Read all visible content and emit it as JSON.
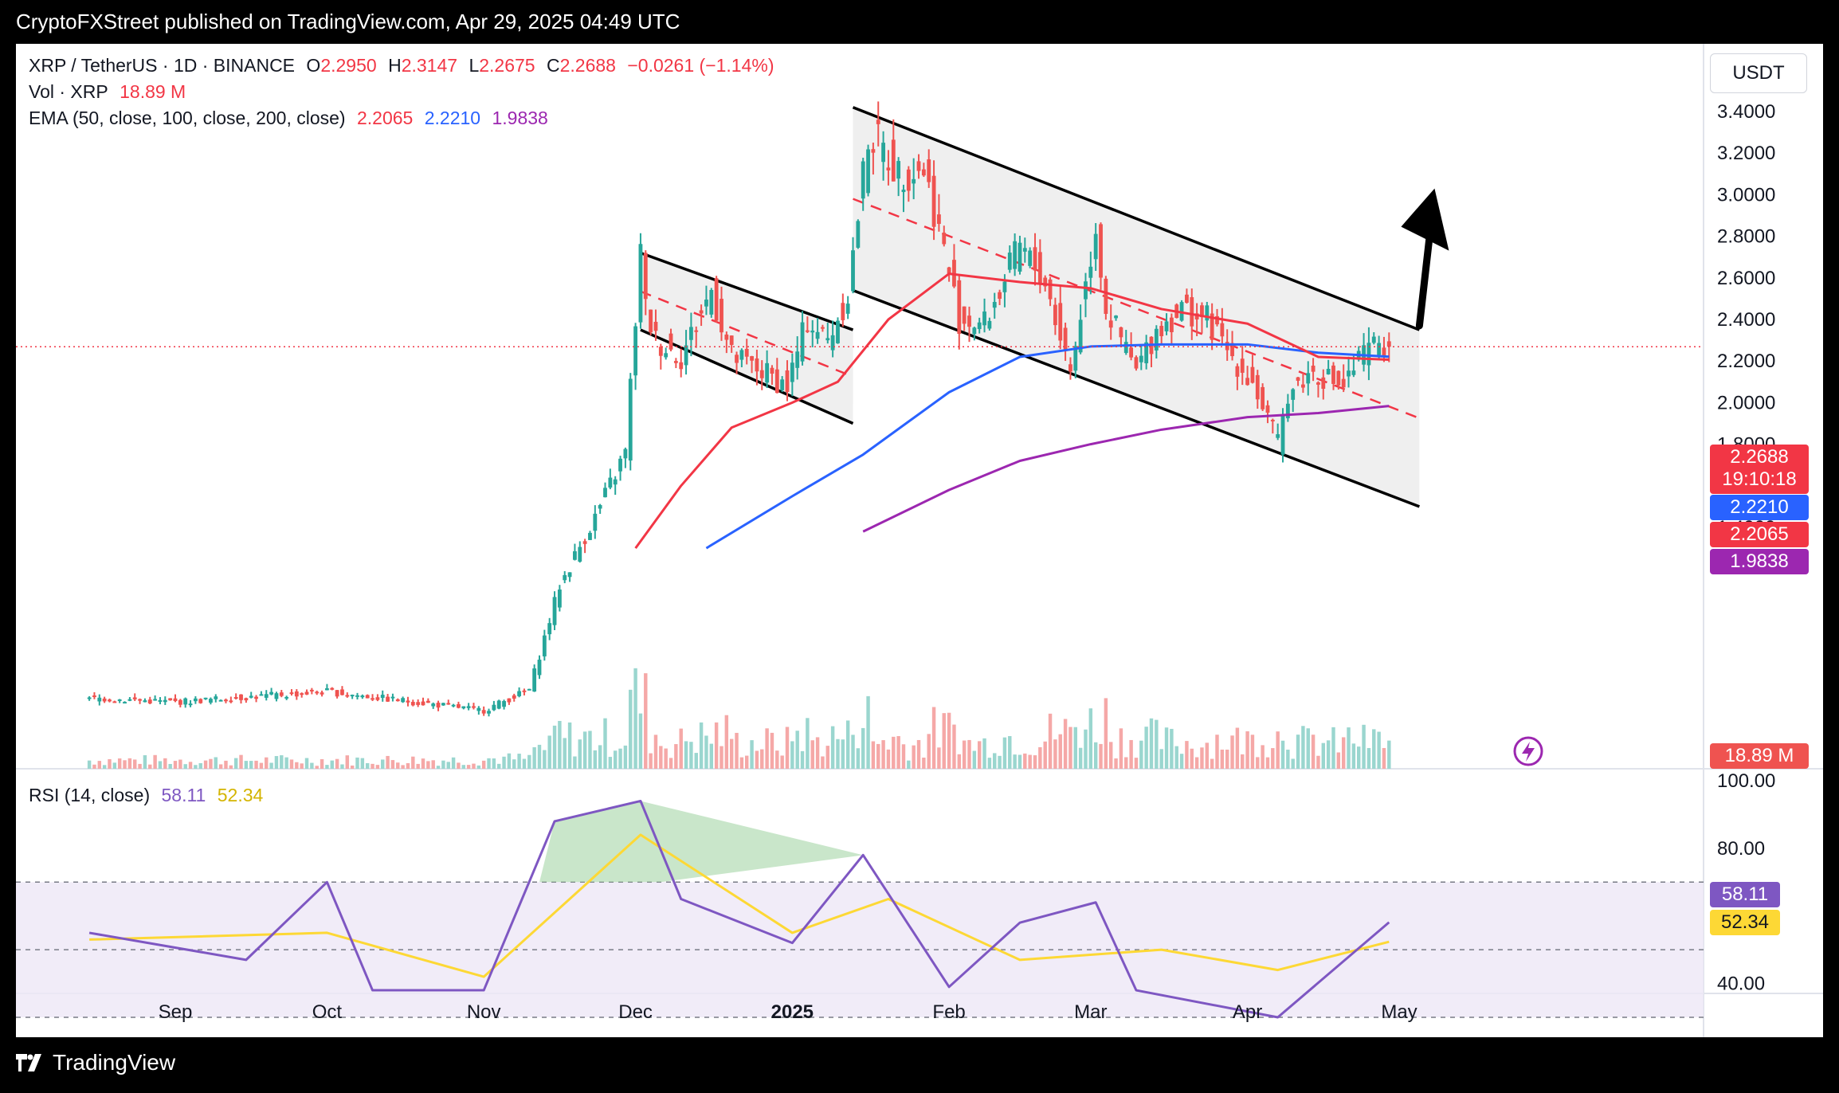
{
  "header": {
    "publisher_line": "CryptoFXStreet published on TradingView.com, Apr 29, 2025 04:49 UTC"
  },
  "footer": {
    "brand": "TradingView"
  },
  "legend": {
    "symbol": "XRP / TetherUS · 1D · BINANCE",
    "open_label": "O",
    "open": "2.2950",
    "high_label": "H",
    "high": "2.3147",
    "low_label": "L",
    "low": "2.2675",
    "close_label": "C",
    "close": "2.2688",
    "change": "−0.0261 (−1.14%)",
    "vol_label": "Vol · XRP",
    "vol_value": "18.89 M",
    "ema_label": "EMA (50, close, 100, close, 200, close)",
    "ema50": "2.2065",
    "ema100": "2.2210",
    "ema200": "1.9838",
    "rsi_label": "RSI (14, close)",
    "rsi_value": "58.11",
    "rsi_ma": "52.34"
  },
  "price_axis": {
    "unit": "USDT",
    "ticks": [
      "3.4000",
      "3.2000",
      "3.0000",
      "2.8000",
      "2.6000",
      "2.4000",
      "2.2000",
      "2.0000",
      "1.8000",
      "1.6000",
      "1.4000"
    ]
  },
  "rsi_axis": {
    "ticks": [
      "100.00",
      "80.00",
      "40.00"
    ]
  },
  "x_axis": {
    "ticks": [
      "Sep",
      "Oct",
      "Nov",
      "Dec",
      "2025",
      "Feb",
      "Mar",
      "Apr",
      "May"
    ]
  },
  "tags": {
    "price": "2.2688",
    "countdown": "19:10:18",
    "ema100": "2.2210",
    "ema50": "2.2065",
    "ema200": "1.9838",
    "volume": "18.89 M",
    "rsi": "58.11",
    "rsi_ma": "52.34"
  },
  "colors": {
    "up": "#26a69a",
    "down": "#ef5350",
    "ema50": "#f23645",
    "ema100": "#2962ff",
    "ema200": "#9c27b0",
    "rsi": "#7e57c2",
    "rsi_ma": "#fdd835",
    "channel_fill": "#ededed"
  },
  "chart_data": {
    "type": "candlestick",
    "symbol": "XRP/USDT",
    "timeframe": "1D",
    "price_range": [
      1.35,
      3.52
    ],
    "rsi_range": [
      27,
      101
    ],
    "rsi_levels": [
      70,
      50,
      30
    ],
    "x_ticks": [
      "Sep",
      "Oct",
      "Nov",
      "Dec",
      "2025",
      "Feb",
      "Mar",
      "Apr",
      "May"
    ],
    "ohlc_points": [
      {
        "date": "2024-08-15",
        "close": 0.58
      },
      {
        "date": "2024-09-01",
        "close": 0.56
      },
      {
        "date": "2024-10-01",
        "close": 0.61
      },
      {
        "date": "2024-11-01",
        "close": 0.52
      },
      {
        "date": "2024-11-10",
        "close": 0.62
      },
      {
        "date": "2024-11-16",
        "close": 1.12
      },
      {
        "date": "2024-11-23",
        "close": 1.45
      },
      {
        "date": "2024-11-29",
        "close": 1.76
      },
      {
        "date": "2024-12-02",
        "close": 2.72
      },
      {
        "date": "2024-12-03",
        "close": 2.45
      },
      {
        "date": "2024-12-05",
        "close": 2.3
      },
      {
        "date": "2024-12-10",
        "close": 2.22
      },
      {
        "date": "2024-12-16",
        "close": 2.54
      },
      {
        "date": "2024-12-20",
        "close": 2.22
      },
      {
        "date": "2024-12-26",
        "close": 2.15
      },
      {
        "date": "2024-12-31",
        "close": 2.08
      },
      {
        "date": "2025-01-04",
        "close": 2.4
      },
      {
        "date": "2025-01-08",
        "close": 2.3
      },
      {
        "date": "2025-01-12",
        "close": 2.52
      },
      {
        "date": "2025-01-16",
        "close": 3.28
      },
      {
        "date": "2025-01-18",
        "close": 3.25
      },
      {
        "date": "2025-01-22",
        "close": 3.1
      },
      {
        "date": "2025-01-27",
        "close": 3.13
      },
      {
        "date": "2025-02-01",
        "close": 2.63
      },
      {
        "date": "2025-02-03",
        "close": 2.4
      },
      {
        "date": "2025-02-08",
        "close": 2.38
      },
      {
        "date": "2025-02-15",
        "close": 2.75
      },
      {
        "date": "2025-02-20",
        "close": 2.58
      },
      {
        "date": "2025-02-25",
        "close": 2.15
      },
      {
        "date": "2025-03-02",
        "close": 2.85
      },
      {
        "date": "2025-03-04",
        "close": 2.45
      },
      {
        "date": "2025-03-10",
        "close": 2.15
      },
      {
        "date": "2025-03-14",
        "close": 2.35
      },
      {
        "date": "2025-03-19",
        "close": 2.45
      },
      {
        "date": "2025-03-24",
        "close": 2.4
      },
      {
        "date": "2025-03-28",
        "close": 2.25
      },
      {
        "date": "2025-04-02",
        "close": 2.1
      },
      {
        "date": "2025-04-07",
        "close": 1.8
      },
      {
        "date": "2025-04-09",
        "close": 2.05
      },
      {
        "date": "2025-04-14",
        "close": 2.15
      },
      {
        "date": "2025-04-20",
        "close": 2.08
      },
      {
        "date": "2025-04-23",
        "close": 2.2
      },
      {
        "date": "2025-04-27",
        "close": 2.3
      },
      {
        "date": "2025-04-29",
        "open": 2.295,
        "high": 2.3147,
        "low": 2.2675,
        "close": 2.2688
      }
    ],
    "series": [
      {
        "name": "EMA 50",
        "last": 2.2065,
        "points": [
          [
            "2024-12-01",
            1.3
          ],
          [
            "2024-12-10",
            1.6
          ],
          [
            "2024-12-20",
            1.88
          ],
          [
            "2025-01-01",
            2.0
          ],
          [
            "2025-01-10",
            2.1
          ],
          [
            "2025-01-20",
            2.4
          ],
          [
            "2025-02-01",
            2.62
          ],
          [
            "2025-02-15",
            2.58
          ],
          [
            "2025-03-01",
            2.55
          ],
          [
            "2025-03-15",
            2.45
          ],
          [
            "2025-04-01",
            2.38
          ],
          [
            "2025-04-15",
            2.22
          ],
          [
            "2025-04-29",
            2.2065
          ]
        ]
      },
      {
        "name": "EMA 100",
        "last": 2.221,
        "points": [
          [
            "2024-12-15",
            1.3
          ],
          [
            "2025-01-01",
            1.55
          ],
          [
            "2025-01-15",
            1.75
          ],
          [
            "2025-02-01",
            2.05
          ],
          [
            "2025-02-15",
            2.22
          ],
          [
            "2025-03-01",
            2.27
          ],
          [
            "2025-03-15",
            2.28
          ],
          [
            "2025-04-01",
            2.28
          ],
          [
            "2025-04-15",
            2.24
          ],
          [
            "2025-04-29",
            2.221
          ]
        ]
      },
      {
        "name": "EMA 200",
        "last": 1.9838,
        "points": [
          [
            "2025-01-15",
            1.38
          ],
          [
            "2025-02-01",
            1.58
          ],
          [
            "2025-02-15",
            1.72
          ],
          [
            "2025-03-01",
            1.8
          ],
          [
            "2025-03-15",
            1.87
          ],
          [
            "2025-04-01",
            1.93
          ],
          [
            "2025-04-15",
            1.95
          ],
          [
            "2025-04-29",
            1.9838
          ]
        ]
      },
      {
        "name": "RSI 14",
        "last": 58.11,
        "points": [
          [
            "2024-08-15",
            55
          ],
          [
            "2024-09-15",
            47
          ],
          [
            "2024-10-01",
            70
          ],
          [
            "2024-10-10",
            38
          ],
          [
            "2024-11-01",
            38
          ],
          [
            "2024-11-15",
            88
          ],
          [
            "2024-12-02",
            94
          ],
          [
            "2024-12-10",
            65
          ],
          [
            "2025-01-01",
            52
          ],
          [
            "2025-01-15",
            78
          ],
          [
            "2025-02-01",
            39
          ],
          [
            "2025-02-15",
            58
          ],
          [
            "2025-03-02",
            64
          ],
          [
            "2025-03-10",
            38
          ],
          [
            "2025-04-07",
            30
          ],
          [
            "2025-04-29",
            58.11
          ]
        ]
      },
      {
        "name": "RSI MA",
        "last": 52.34,
        "points": [
          [
            "2024-08-15",
            53
          ],
          [
            "2024-10-01",
            55
          ],
          [
            "2024-11-01",
            42
          ],
          [
            "2024-12-02",
            84
          ],
          [
            "2025-01-01",
            55
          ],
          [
            "2025-01-20",
            65
          ],
          [
            "2025-02-15",
            47
          ],
          [
            "2025-03-15",
            50
          ],
          [
            "2025-04-07",
            44
          ],
          [
            "2025-04-29",
            52.34
          ]
        ]
      }
    ],
    "drawings": {
      "small_channel": {
        "upper": [
          [
            "2024-12-02",
            2.72
          ],
          [
            "2025-01-13",
            2.35
          ]
        ],
        "lower": [
          [
            "2024-12-02",
            2.35
          ],
          [
            "2025-01-13",
            1.9
          ]
        ],
        "mid_dashed": true
      },
      "large_channel": {
        "upper": [
          [
            "2025-01-13",
            3.42
          ],
          [
            "2025-05-05",
            2.35
          ]
        ],
        "lower": [
          [
            "2025-01-13",
            2.54
          ],
          [
            "2025-05-05",
            1.5
          ]
        ],
        "mid_dashed": true
      },
      "arrow": {
        "from": [
          "2025-05-05",
          2.37
        ],
        "to": [
          "2025-05-08",
          3.03
        ],
        "direction": "up"
      }
    }
  }
}
